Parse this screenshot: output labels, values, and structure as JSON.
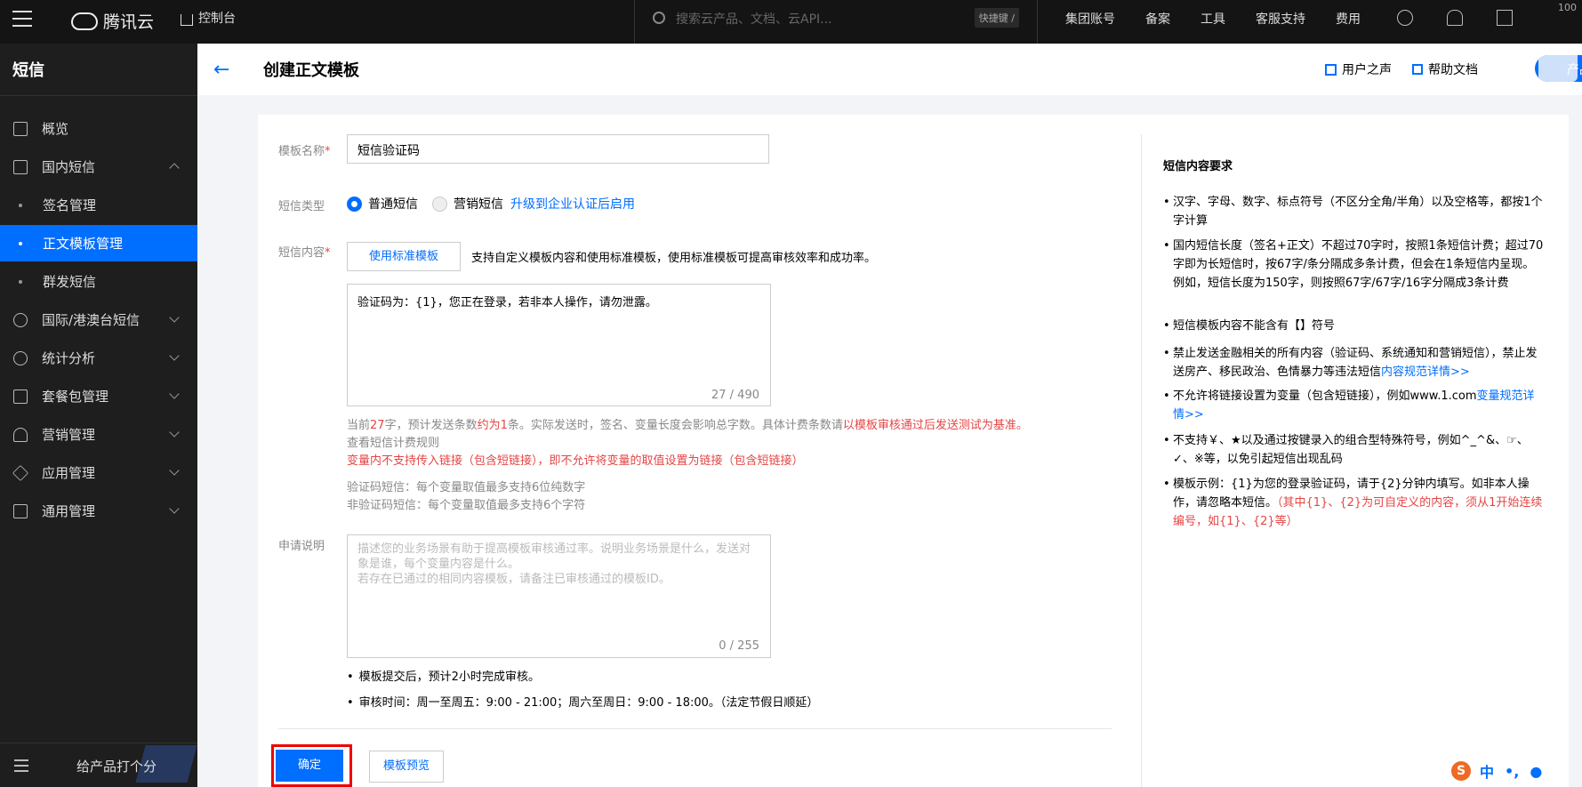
{
  "topbar": {
    "brand": "腾讯云",
    "console": "控制台",
    "search_placeholder": "搜索云产品、文档、云API...",
    "shortcut": "快捷键 /",
    "links": [
      "集团账号",
      "备案",
      "工具",
      "客服支持",
      "费用"
    ],
    "right_text": "100"
  },
  "sidebar": {
    "title": "短信",
    "items": [
      {
        "label": "概览",
        "icon": "grid-icon"
      },
      {
        "label": "国内短信",
        "icon": "mail-icon"
      },
      {
        "label": "签名管理"
      },
      {
        "label": "正文模板管理"
      },
      {
        "label": "群发短信"
      },
      {
        "label": "国际/港澳台短信",
        "icon": "globe-icon"
      },
      {
        "label": "统计分析",
        "icon": "pie-chart-icon"
      },
      {
        "label": "套餐包管理",
        "icon": "package-icon"
      },
      {
        "label": "营销管理",
        "icon": "user-icon"
      },
      {
        "label": "应用管理",
        "icon": "layers-icon"
      },
      {
        "label": "通用管理",
        "icon": "sliders-icon"
      }
    ],
    "feedback": "给产品打个分"
  },
  "header": {
    "title": "创建正文模板",
    "user_voice": "用户之声",
    "help_doc": "帮助文档",
    "product_exp": "产品体"
  },
  "form": {
    "name_label": "模板名称",
    "name_value": "短信验证码",
    "type_label": "短信类型",
    "type_normal": "普通短信",
    "type_marketing": "营销短信",
    "upgrade_link": "升级到企业认证后启用",
    "content_label": "短信内容",
    "use_std_btn": "使用标准模板",
    "std_desc": "支持自定义模板内容和使用标准模板，使用标准模板可提高审核效率和成功率。",
    "content_value": "验证码为：{1}，您正在登录，若非本人操作，请勿泄露。",
    "content_count": "27 / 490",
    "count_note_1": "当前",
    "count_note_num": "27",
    "count_note_2": "字，预计发送条数",
    "count_note_approx": "约为1",
    "count_note_3": "条。实际发送时，签名、变量长度会影响总字数。具体计费条数请",
    "count_note_red": "以模板审核通过后发送测试为基准。",
    "billing_link": "查看短信计费规则",
    "link_warning": "变量内不支持传入链接（包含短链接），即不允许将变量的取值设置为链接（包含短链接）",
    "var_note_1": "验证码短信：每个变量取值最多支持6位纯数字",
    "var_note_2": "非验证码短信：每个变量取值最多支持6个字符",
    "apply_label": "申请说明",
    "apply_placeholder_1": "描述您的业务场景有助于提高模板审核通过率。说明业务场景是什么，发送对象是谁，每个变量内容是什么。",
    "apply_placeholder_2": "若存在已通过的相同内容模板，请备注已审核通过的模板ID。",
    "apply_count": "0 / 255",
    "bullet_1": "模板提交后，预计2小时完成审核。",
    "bullet_2": "审核时间：周一至周五：9:00 - 21:00；周六至周日：9:00 - 18:00。（法定节假日顺延）",
    "confirm_btn": "确定",
    "preview_btn": "模板预览"
  },
  "requirements": {
    "title": "短信内容要求",
    "items": [
      "汉字、字母、数字、标点符号（不区分全角/半角）以及空格等，都按1个字计算",
      "国内短信长度（签名+正文）不超过70字时，按照1条短信计费；超过70字即为长短信时，按67字/条分隔成多条计费，但会在1条短信内呈现。例如，短信长度为150字，则按照67字/67字/16字分隔成3条计费",
      "短信模板内容不能含有【】符号",
      "禁止发送金融相关的所有内容（验证码、系统通知和营销短信），禁止发送房产、移民政治、色情暴力等违法短信",
      "不允许将链接设置为变量（包含短链接），例如www.1.com",
      "不支持￥、★以及通过按键录入的组合型特殊符号，例如^_^&、☞、✓、※等，以免引起短信出现乱码",
      "模板示例：{1}为您的登录验证码，请于{2}分钟内填写。如非本人操作，请忽略本短信。"
    ],
    "link_1": "内容规范详情>>",
    "link_2": "变量规范详情>>",
    "example_note": "（其中{1}、{2}为可自定义的内容，须从1开始连续编号，如{1}、{2}等）"
  },
  "ime": {
    "lang": "中",
    "punct": "•,"
  },
  "colors": {
    "accent": "#006eff",
    "danger": "#e54545",
    "topbar": "#141414",
    "sidebar": "#1e1e1e"
  }
}
